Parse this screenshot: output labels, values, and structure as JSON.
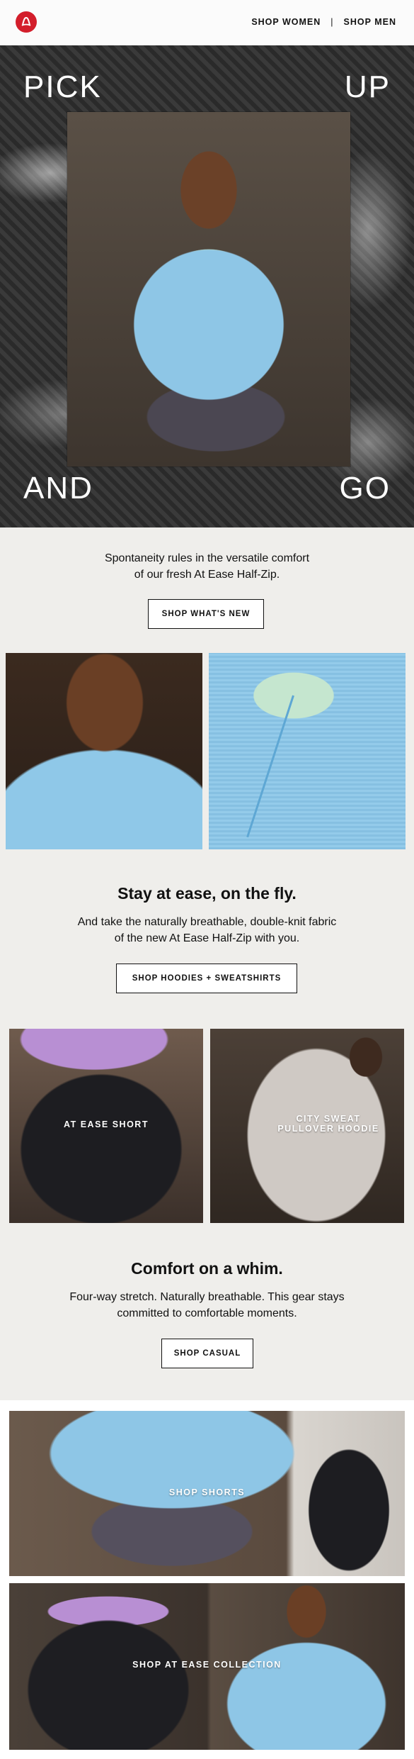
{
  "header": {
    "logo_name": "lululemon-logo",
    "nav": [
      {
        "label": "SHOP WOMEN"
      },
      {
        "separator": "|"
      },
      {
        "label": "SHOP MEN"
      }
    ]
  },
  "hero": {
    "words": [
      "PICK",
      "UP",
      "AND",
      "GO"
    ]
  },
  "intro": {
    "text_line1": "Spontaneity rules in the versatile comfort",
    "text_line2": "of our fresh At Ease Half-Zip.",
    "button": "SHOP WHAT'S NEW"
  },
  "section_ease": {
    "title": "Stay at ease, on the fly.",
    "text_line1": "And take the naturally breathable, double-knit fabric",
    "text_line2": "of the new At Ease Half-Zip with you.",
    "button": "SHOP HOODIES + SWEATSHIRTS"
  },
  "products": [
    {
      "label_line1": "AT EASE SHORT",
      "label_line2": ""
    },
    {
      "label_line1": "CITY SWEAT",
      "label_line2": "PULLOVER HOODIE"
    }
  ],
  "section_comfort": {
    "title": "Comfort on a whim.",
    "text_line1": "Four-way stretch. Naturally breathable. This gear stays",
    "text_line2": "committed to comfortable moments.",
    "button": "SHOP CASUAL"
  },
  "banners": [
    {
      "label": "SHOP SHORTS"
    },
    {
      "label": "SHOP AT EASE COLLECTION"
    }
  ],
  "colors": {
    "brand_red": "#d31e2b",
    "page_bg": "#efeeeb",
    "text": "#111111"
  }
}
